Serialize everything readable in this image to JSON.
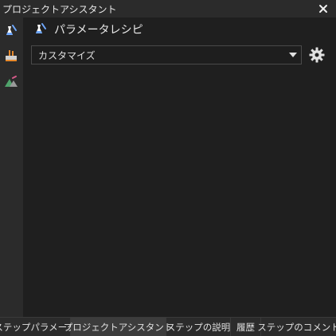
{
  "window": {
    "title": "プロジェクトアシスタント",
    "close_icon": "close-icon"
  },
  "leftbar": {
    "tools": [
      {
        "name": "flask-icon",
        "active": true
      },
      {
        "name": "cauldron-icon",
        "active": false
      },
      {
        "name": "mountain-icon",
        "active": false
      }
    ]
  },
  "section": {
    "icon": "flask-icon",
    "title": "パラメータレシピ"
  },
  "dropdown": {
    "selected": "カスタマイズ"
  },
  "tabs": [
    {
      "label": "ステップパラメータ",
      "active": false
    },
    {
      "label": "プロジェクトアシスタント",
      "active": true
    },
    {
      "label": "ステップの説明",
      "active": false
    },
    {
      "label": "履歴",
      "active": false
    },
    {
      "label": "ステップのコメント",
      "active": false
    }
  ],
  "colors": {
    "background": "#2b2b2b",
    "content": "#1f1f1f",
    "active_tab": "#3c3c3c",
    "flask_blue": "#6fa8ff",
    "orange": "#e88a2c",
    "green": "#4fa36b"
  }
}
